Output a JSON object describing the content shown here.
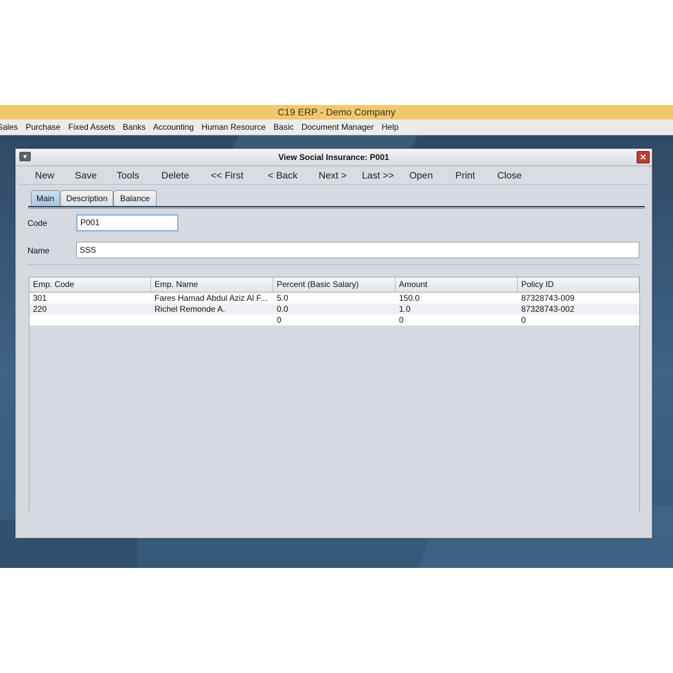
{
  "app_title": "C19 ERP - Demo Company",
  "menu": [
    "Sales",
    "Purchase",
    "Fixed Assets",
    "Banks",
    "Accounting",
    "Human Resource",
    "Basic",
    "Document Manager",
    "Help"
  ],
  "window": {
    "title": "View Social Insurance: P001",
    "close_glyph": "✕",
    "menu_glyph": "▼"
  },
  "toolbar": {
    "new": "New",
    "save": "Save",
    "tools": "Tools",
    "delete": "Delete",
    "first": "<< First",
    "back": "< Back",
    "next": "Next >",
    "last": "Last >>",
    "open": "Open",
    "print": "Print",
    "close": "Close"
  },
  "tabs": {
    "main": "Main",
    "description": "Description",
    "balance": "Balance"
  },
  "form": {
    "code_label": "Code",
    "code_value": "P001",
    "name_label": "Name",
    "name_value": "SSS"
  },
  "table": {
    "columns": [
      "Emp. Code",
      "Emp. Name",
      "Percent (Basic Salary)",
      "Amount",
      "Policy ID"
    ],
    "rows": [
      [
        "301",
        "Fares Hamad Abdul Aziz Al F...",
        "5.0",
        "150.0",
        "87328743-009"
      ],
      [
        "220",
        "Richel Remonde A.",
        "0.0",
        "1.0",
        "87328743-002"
      ],
      [
        "",
        "",
        "0",
        "0",
        "0"
      ]
    ]
  },
  "colors": {
    "title_bar": "#f1c96a",
    "desktop": "#3d6385",
    "close_button": "#c43a31",
    "tab_active": "#aac6e2"
  }
}
